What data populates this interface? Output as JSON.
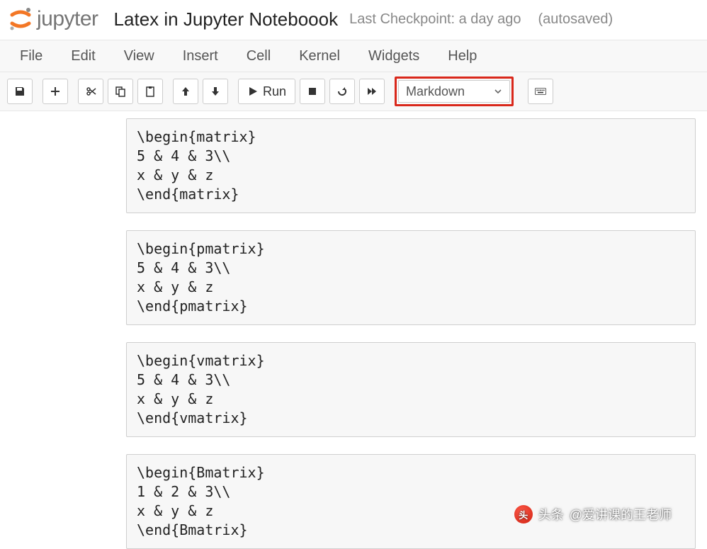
{
  "header": {
    "logo_text": "jupyter",
    "title": "Latex in Jupyter Noteboook",
    "checkpoint": "Last Checkpoint: a day ago",
    "autosaved": "(autosaved)"
  },
  "menu": {
    "file": "File",
    "edit": "Edit",
    "view": "View",
    "insert": "Insert",
    "cell": "Cell",
    "kernel": "Kernel",
    "widgets": "Widgets",
    "help": "Help"
  },
  "toolbar": {
    "run_label": "Run",
    "cell_type": "Markdown"
  },
  "cells": [
    "\\begin{matrix}\n5 & 4 & 3\\\\\nx & y & z\n\\end{matrix}",
    "\\begin{pmatrix}\n5 & 4 & 3\\\\\nx & y & z\n\\end{pmatrix}",
    "\\begin{vmatrix}\n5 & 4 & 3\\\\\nx & y & z\n\\end{vmatrix}",
    "\\begin{Bmatrix}\n1 & 2 & 3\\\\\nx & y & z\n\\end{Bmatrix}"
  ],
  "watermark": {
    "prefix": "头条",
    "text": "@爱讲课的王老师"
  }
}
